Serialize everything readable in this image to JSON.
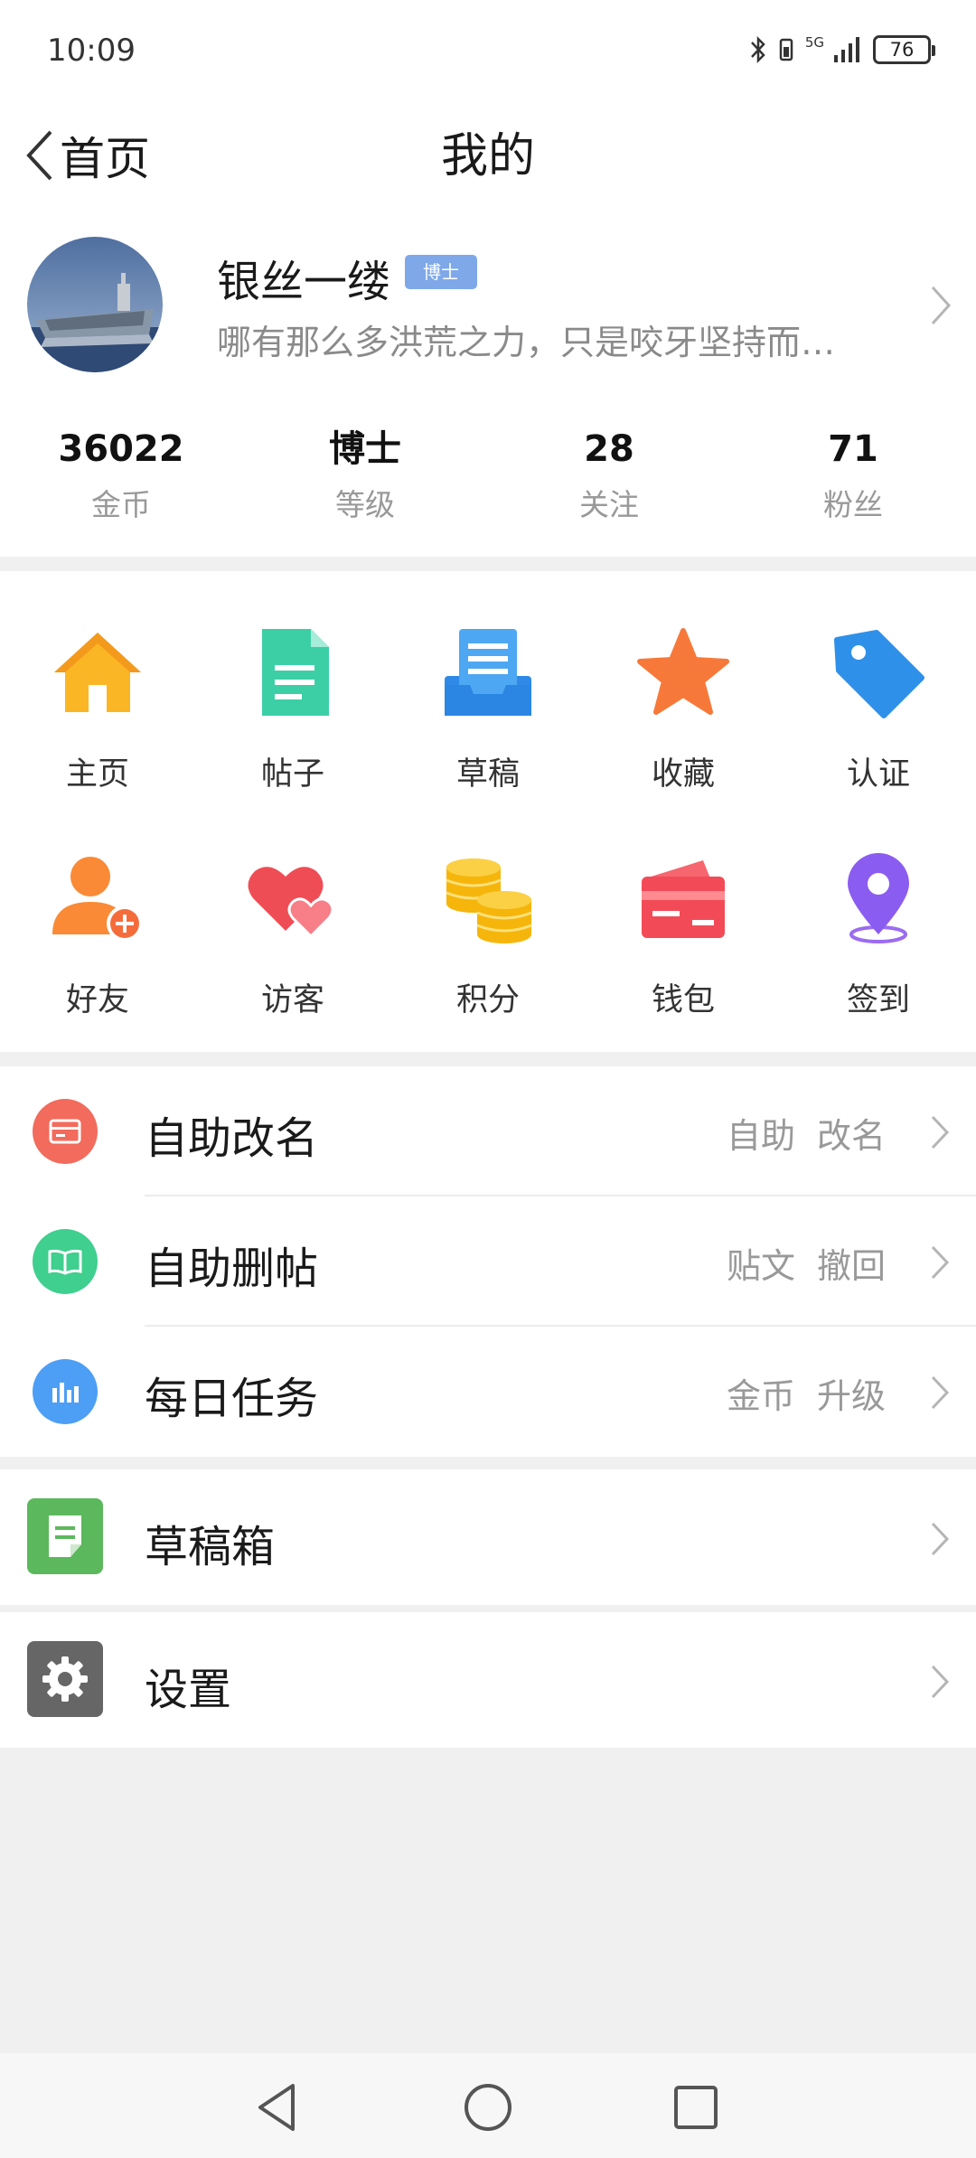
{
  "status_bar": {
    "time": "10:09",
    "battery": "76",
    "network": "5G"
  },
  "nav": {
    "back_label": "首页",
    "title": "我的"
  },
  "profile": {
    "name": "银丝一缕",
    "badge": "博士",
    "signature": "哪有那么多洪荒之力，只是咬牙坚持而…"
  },
  "stats": [
    {
      "value": "36022",
      "label": "金币"
    },
    {
      "value": "博士",
      "label": "等级"
    },
    {
      "value": "28",
      "label": "关注"
    },
    {
      "value": "71",
      "label": "粉丝"
    }
  ],
  "grid": [
    {
      "label": "主页",
      "icon": "home-icon"
    },
    {
      "label": "帖子",
      "icon": "document-icon"
    },
    {
      "label": "草稿",
      "icon": "draft-tray-icon"
    },
    {
      "label": "收藏",
      "icon": "star-icon"
    },
    {
      "label": "认证",
      "icon": "tag-icon"
    },
    {
      "label": "好友",
      "icon": "add-friend-icon"
    },
    {
      "label": "访客",
      "icon": "hearts-icon"
    },
    {
      "label": "积分",
      "icon": "coins-icon"
    },
    {
      "label": "钱包",
      "icon": "wallet-icon"
    },
    {
      "label": "签到",
      "icon": "location-pin-icon"
    }
  ],
  "list": [
    {
      "label": "自助改名",
      "tags": [
        "自助",
        "改名"
      ],
      "icon": "card-icon",
      "color": "#f26b5c"
    },
    {
      "label": "自助删帖",
      "tags": [
        "贴文",
        "撤回"
      ],
      "icon": "book-icon",
      "color": "#3fcf8e"
    },
    {
      "label": "每日任务",
      "tags": [
        "金币",
        "升级"
      ],
      "icon": "bar-chart-icon",
      "color": "#4d9ef5"
    }
  ],
  "drafts": {
    "label": "草稿箱",
    "icon": "draft-box-icon",
    "color": "#5cb85c"
  },
  "settings": {
    "label": "设置",
    "icon": "gear-icon",
    "color": "#666666"
  }
}
